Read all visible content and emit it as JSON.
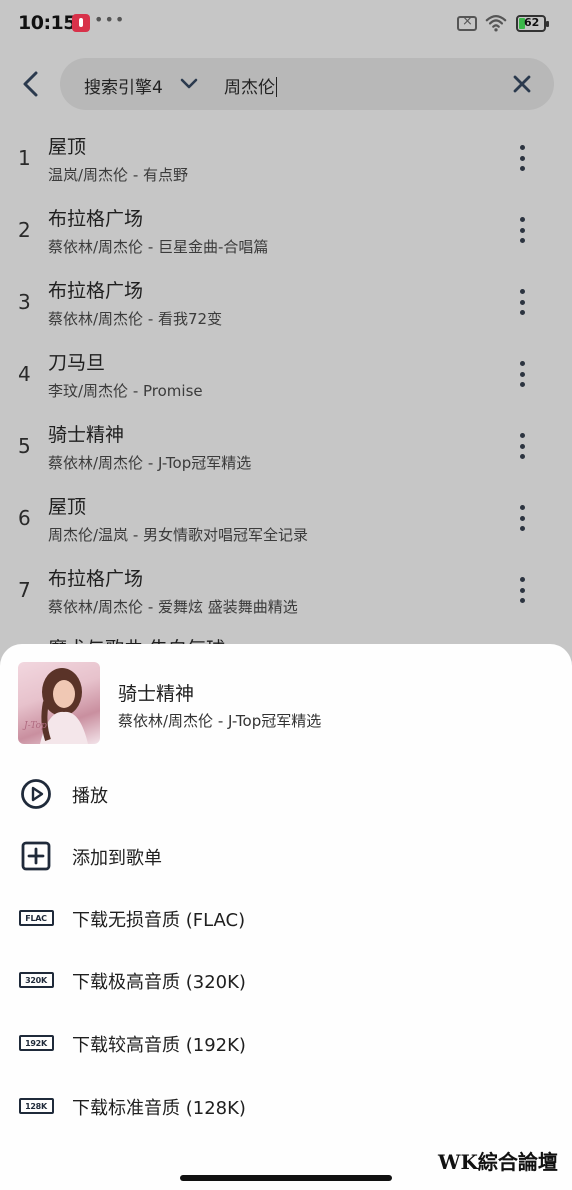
{
  "status_bar": {
    "time": "10:15",
    "dots": "•••",
    "battery": "62",
    "icons": [
      "music-app-icon",
      "sim-off-icon",
      "wifi-icon",
      "battery-icon"
    ]
  },
  "search": {
    "engine": "搜索引擎4",
    "query": "周杰伦",
    "icons": [
      "back-arrow-icon",
      "chevron-down-icon",
      "close-icon"
    ]
  },
  "results": [
    {
      "num": "1",
      "title": "屋顶",
      "sub": "温岚/周杰伦 - 有点野"
    },
    {
      "num": "2",
      "title": "布拉格广场",
      "sub": "蔡依林/周杰伦 - 巨星金曲-合唱篇"
    },
    {
      "num": "3",
      "title": "布拉格广场",
      "sub": "蔡依林/周杰伦 - 看我72变"
    },
    {
      "num": "4",
      "title": "刀马旦",
      "sub": "李玟/周杰伦 - Promise"
    },
    {
      "num": "5",
      "title": "骑士精神",
      "sub": "蔡依林/周杰伦 - J-Top冠军精选"
    },
    {
      "num": "6",
      "title": "屋顶",
      "sub": "周杰伦/温岚 - 男女情歌对唱冠军全记录"
    },
    {
      "num": "7",
      "title": "布拉格广场",
      "sub": "蔡依林/周杰伦 - 爱舞炫 盛装舞曲精选"
    },
    {
      "num": "",
      "title": "魔术与歌曲·告白气球",
      "sub": ""
    }
  ],
  "sheet": {
    "song_title": "骑士精神",
    "song_sub": "蔡依林/周杰伦 - J-Top冠军精选",
    "actions": [
      {
        "label": "播放",
        "icon": "play-circle-icon"
      },
      {
        "label": "添加到歌单",
        "icon": "add-square-icon"
      },
      {
        "label": "下载无损音质 (FLAC)",
        "icon": "flac-icon",
        "badge": "FLAC"
      },
      {
        "label": "下载极高音质 (320K)",
        "icon": "320k-icon",
        "badge": "320K"
      },
      {
        "label": "下载较高音质 (192K)",
        "icon": "192k-icon",
        "badge": "192K"
      },
      {
        "label": "下载标准音质 (128K)",
        "icon": "128k-icon",
        "badge": "128K"
      }
    ]
  },
  "watermark": "WK綜合論壇",
  "colors": {
    "dim_background": "#c6c6c6",
    "search_pill": "#b8b8b8",
    "sheet_background": "#fefefe",
    "icon_dark": "#1f2a3a"
  }
}
